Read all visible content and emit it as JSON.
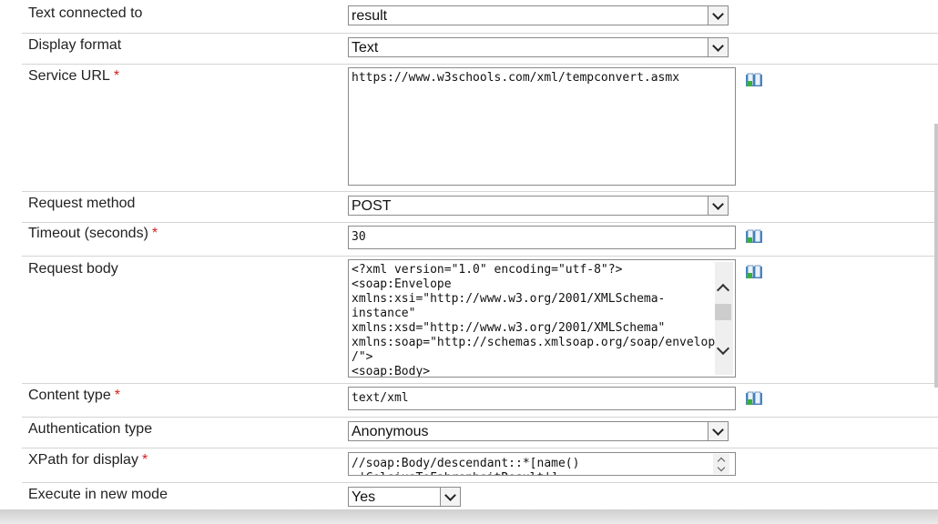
{
  "fields": {
    "text_connected_to": {
      "label": "Text connected to",
      "value": "result"
    },
    "display_format": {
      "label": "Display format",
      "value": "Text"
    },
    "service_url": {
      "label": "Service URL",
      "required": "*",
      "value": "https://www.w3schools.com/xml/tempconvert.asmx"
    },
    "request_method": {
      "label": "Request method",
      "value": "POST"
    },
    "timeout": {
      "label": "Timeout (seconds)",
      "required": "*",
      "value": "30"
    },
    "request_body": {
      "label": "Request body",
      "value": "<?xml version=\"1.0\" encoding=\"utf-8\"?>\n<soap:Envelope\nxmlns:xsi=\"http://www.w3.org/2001/XMLSchema-\ninstance\"\nxmlns:xsd=\"http://www.w3.org/2001/XMLSchema\"\nxmlns:soap=\"http://schemas.xmlsoap.org/soap/envelope\n/\">\n<soap:Body>"
    },
    "content_type": {
      "label": "Content type",
      "required": "*",
      "value": "text/xml"
    },
    "auth_type": {
      "label": "Authentication type",
      "value": "Anonymous"
    },
    "xpath": {
      "label": "XPath for display",
      "required": "*",
      "value": "//soap:Body/descendant::*[name()\n='CelsiusToFahrenheitResult']"
    },
    "execute_new_mode": {
      "label": "Execute in new mode",
      "value": "Yes"
    }
  },
  "icons": {
    "macro": "book-macro-icon"
  }
}
